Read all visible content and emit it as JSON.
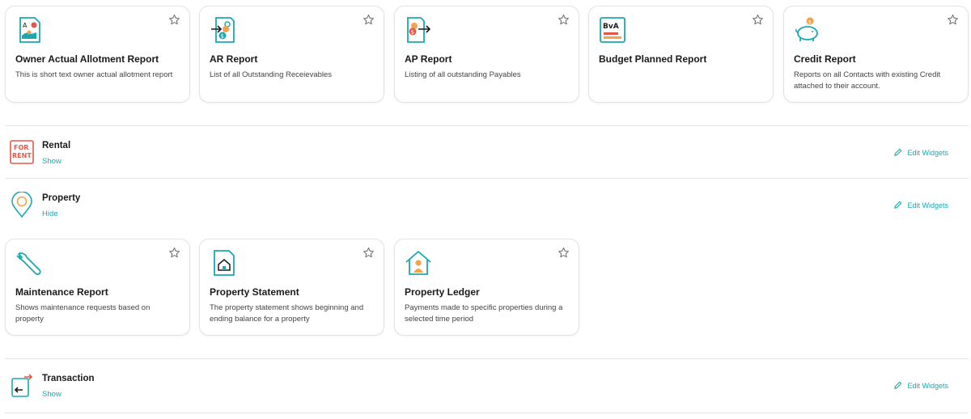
{
  "cards_top": [
    {
      "title": "Owner Actual Allotment Report",
      "desc": "This is short text owner actual allotment report",
      "icon": "owner-allotment-icon"
    },
    {
      "title": "AR Report",
      "desc": "List of all Outstanding Receievables",
      "icon": "ar-report-icon"
    },
    {
      "title": "AP Report",
      "desc": "Listing of all outstanding Payables",
      "icon": "ap-report-icon"
    },
    {
      "title": "Budget Planned Report",
      "desc": "",
      "icon": "budget-bva-icon",
      "icon_text": "BvA"
    },
    {
      "title": "Credit Report",
      "desc": "Reports on all Contacts with existing Credit attached to their account.",
      "icon": "piggy-bank-icon"
    }
  ],
  "sections": {
    "rental": {
      "name": "Rental",
      "toggle": "Show",
      "edit": "Edit Widgets",
      "icon_text_1": "FOR",
      "icon_text_2": "RENT"
    },
    "property": {
      "name": "Property",
      "toggle": "Hide",
      "edit": "Edit Widgets"
    },
    "transaction": {
      "name": "Transaction",
      "toggle": "Show",
      "edit": "Edit Widgets"
    }
  },
  "cards_property": [
    {
      "title": "Maintenance Report",
      "desc": "Shows maintenance requests based on property",
      "icon": "wrench-icon"
    },
    {
      "title": "Property Statement",
      "desc": "The property statement shows beginning and ending balance for a property",
      "icon": "property-statement-icon"
    },
    {
      "title": "Property Ledger",
      "desc": "Payments made to specific properties during a selected time period",
      "icon": "property-ledger-icon"
    }
  ],
  "colors": {
    "accent": "#1aa9b0",
    "orange": "#f5a24a",
    "red": "#e8564a",
    "border": "#e3e3e3"
  }
}
